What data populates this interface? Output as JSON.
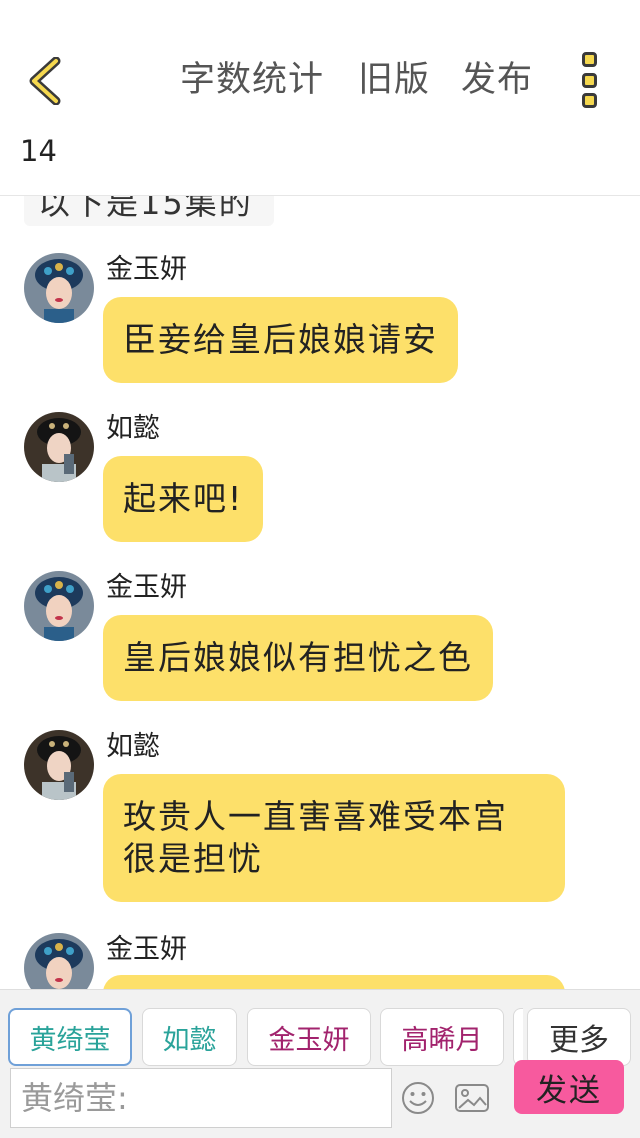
{
  "header": {
    "back_icon": "chevron-left-icon",
    "word_count_label": "字数统计",
    "old_version_label": "旧版",
    "publish_label": "发布",
    "menu_icon": "more-vertical-icon",
    "episode_count": "14",
    "accent_color": "#f5d84f"
  },
  "partial_text": "以下是15集的",
  "messages": [
    {
      "sender": "金玉妍",
      "text": "臣妾给皇后娘娘请安",
      "avatar": "portrait-jin-yuyan"
    },
    {
      "sender": "如懿",
      "text": "起来吧!",
      "avatar": "portrait-ruyi"
    },
    {
      "sender": "金玉妍",
      "text": "皇后娘娘似有担忧之色",
      "avatar": "portrait-jin-yuyan"
    },
    {
      "sender": "如懿",
      "text_line1": "玫贵人一直害喜难受本宫",
      "text_line2": "很是担忧",
      "avatar": "portrait-ruyi"
    },
    {
      "sender": "金玉妍",
      "text": "",
      "avatar": "portrait-jin-yuyan"
    }
  ],
  "bubble_color": "#fde06a",
  "roles": [
    {
      "name": "黄绮莹",
      "color": "#2aa39a",
      "active": true
    },
    {
      "name": "如懿",
      "color": "#2aa39a",
      "active": false
    },
    {
      "name": "金玉妍",
      "color": "#a2236d",
      "active": false
    },
    {
      "name": "高晞月",
      "color": "#a2236d",
      "active": false
    }
  ],
  "more_label": "更多",
  "input": {
    "placeholder": "黄绮莹:"
  },
  "emoji_icon": "smiley-icon",
  "image_icon": "image-icon",
  "send_label": "发送",
  "send_color": "#f75a9e"
}
